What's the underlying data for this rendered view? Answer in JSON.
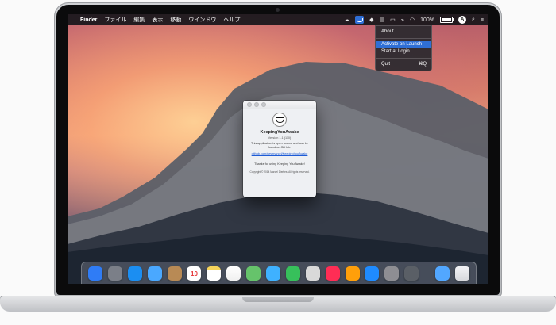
{
  "menubar": {
    "app_name": "Finder",
    "menus": [
      "ファイル",
      "編集",
      "表示",
      "移動",
      "ウインドウ",
      "ヘルプ"
    ],
    "battery_percent_label": "100%"
  },
  "status_dropdown": {
    "items": [
      {
        "label": "About",
        "selected": false
      },
      {
        "label": "Activate on Launch",
        "selected": true
      },
      {
        "label": "Start at Login",
        "selected": false
      },
      {
        "label": "Quit",
        "shortcut": "⌘Q",
        "selected": false
      }
    ]
  },
  "about_window": {
    "app_name": "KeepingYouAwake",
    "version": "Version 1.1 (110)",
    "description": "This application is open source and can be found on GitHub:",
    "link_text": "github.com/newmarcel/KeepingYouAwake",
    "thanks": "Thanks for using Keeping You Awake!",
    "copyright": "Copyright © 2014 Marcel Dierkes. All rights reserved."
  },
  "dock": {
    "apps": [
      {
        "name": "finder-icon",
        "color": "#2f7cf6"
      },
      {
        "name": "launchpad-icon",
        "color": "#7b7f88"
      },
      {
        "name": "safari-icon",
        "color": "#1b8ef2"
      },
      {
        "name": "mail-icon",
        "color": "#4aa8ff"
      },
      {
        "name": "contacts-icon",
        "color": "#b88a55"
      },
      {
        "name": "calendar-icon",
        "color": "#ffffff"
      },
      {
        "name": "notes-icon",
        "color": "#f6d45b"
      },
      {
        "name": "reminders-icon",
        "color": "#ffffff"
      },
      {
        "name": "maps-icon",
        "color": "#66c36b"
      },
      {
        "name": "messages-icon",
        "color": "#3fb1ff"
      },
      {
        "name": "facetime-icon",
        "color": "#37c05b"
      },
      {
        "name": "photos-icon",
        "color": "#d9d9d9"
      },
      {
        "name": "itunes-icon",
        "color": "#ff2d55"
      },
      {
        "name": "ibooks-icon",
        "color": "#ff9f0a"
      },
      {
        "name": "app-store-icon",
        "color": "#1f8bff"
      },
      {
        "name": "system-preferences-icon",
        "color": "#8e8e93"
      },
      {
        "name": "keepingyouawake-app-icon",
        "color": "#5a5f66"
      },
      {
        "name": "downloads-folder-icon",
        "color": "#52a7ff"
      },
      {
        "name": "trash-icon",
        "color": "#e7e7ea"
      }
    ],
    "calendar_day": "10"
  }
}
